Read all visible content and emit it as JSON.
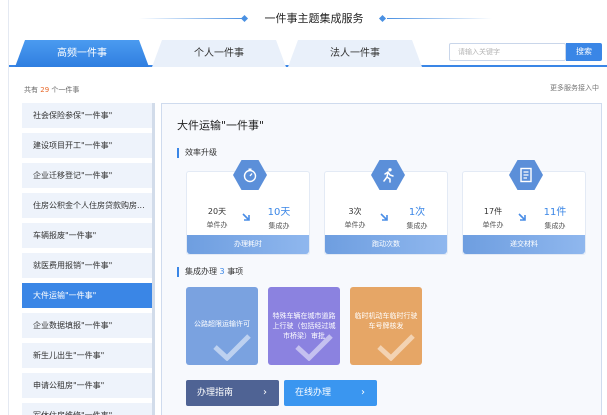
{
  "header": {
    "title": "一件事主题集成服务"
  },
  "tabs": [
    {
      "label": "高频一件事",
      "active": true
    },
    {
      "label": "个人一件事",
      "active": false
    },
    {
      "label": "法人一件事",
      "active": false
    }
  ],
  "search": {
    "placeholder": "请输入关键字",
    "button_label": "搜索"
  },
  "list_meta": {
    "prefix": "共有",
    "count": "29",
    "suffix": "个一件事",
    "more_link": "更多服务接入中"
  },
  "sidebar": {
    "items": [
      {
        "label": "社会保险参保\"一件事\"",
        "active": false
      },
      {
        "label": "建设项目开工\"一件事\"",
        "active": false
      },
      {
        "label": "企业迁移登记\"一件事\"",
        "active": false
      },
      {
        "label": "住房公积金个人住房贷款购房...",
        "active": false
      },
      {
        "label": "车辆报废\"一件事\"",
        "active": false
      },
      {
        "label": "就医费用报销\"一件事\"",
        "active": false
      },
      {
        "label": "大件运输\"一件事\"",
        "active": true
      },
      {
        "label": "企业数据填报\"一件事\"",
        "active": false
      },
      {
        "label": "新生儿出生\"一件事\"",
        "active": false
      },
      {
        "label": "申请公租房\"一件事\"",
        "active": false
      },
      {
        "label": "军休住房维修\"一件事\"",
        "active": false
      }
    ]
  },
  "detail": {
    "title": "大件运输\"一件事\"",
    "efficiency_heading": "效率升级",
    "stats": [
      {
        "icon": "stopwatch-icon",
        "before_value": "20天",
        "before_unit": "单件办",
        "after_value": "10天",
        "after_unit": "集成办",
        "footer": "办理耗时"
      },
      {
        "icon": "running-person-icon",
        "before_value": "3次",
        "before_unit": "单件办",
        "after_value": "1次",
        "after_unit": "集成办",
        "footer": "跑动次数"
      },
      {
        "icon": "document-icon",
        "before_value": "17件",
        "before_unit": "单件办",
        "after_value": "11件",
        "after_unit": "集成办",
        "footer": "递交材料"
      }
    ],
    "integrated_heading": {
      "prefix": "集成办理",
      "count": "3",
      "suffix": "事项"
    },
    "matters": [
      {
        "label": "公路超限运输许可",
        "color": "#7aa2e0"
      },
      {
        "label": "特殊车辆在城市道路上行驶（包括经过城市桥梁）审批",
        "color": "#8b82e0"
      },
      {
        "label": "临时机动车临时行驶车号牌核发",
        "color": "#e6a666"
      }
    ],
    "buttons": {
      "guide": "办理指南",
      "online": "在线办理"
    }
  }
}
